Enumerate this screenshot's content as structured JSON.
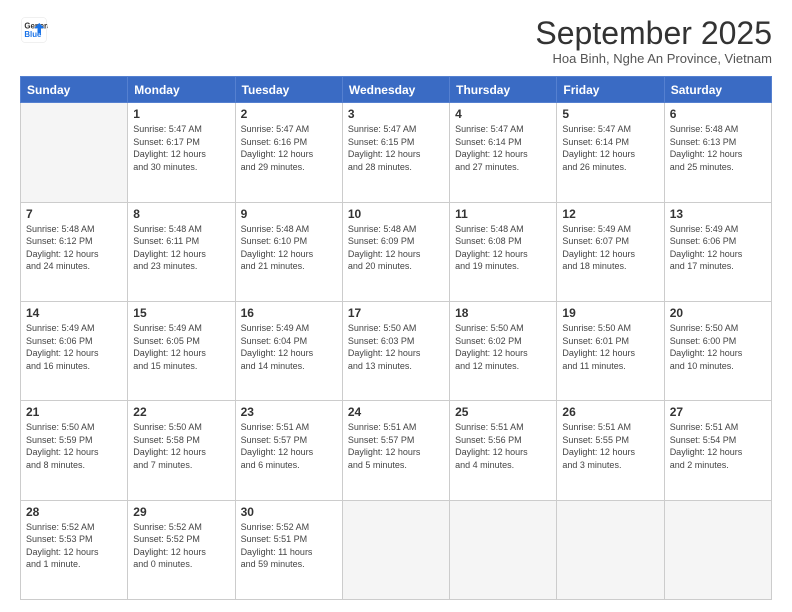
{
  "logo": {
    "line1": "General",
    "line2": "Blue"
  },
  "header": {
    "month": "September 2025",
    "location": "Hoa Binh, Nghe An Province, Vietnam"
  },
  "days": [
    "Sunday",
    "Monday",
    "Tuesday",
    "Wednesday",
    "Thursday",
    "Friday",
    "Saturday"
  ],
  "weeks": [
    [
      {
        "day": "",
        "info": ""
      },
      {
        "day": "1",
        "info": "Sunrise: 5:47 AM\nSunset: 6:17 PM\nDaylight: 12 hours\nand 30 minutes."
      },
      {
        "day": "2",
        "info": "Sunrise: 5:47 AM\nSunset: 6:16 PM\nDaylight: 12 hours\nand 29 minutes."
      },
      {
        "day": "3",
        "info": "Sunrise: 5:47 AM\nSunset: 6:15 PM\nDaylight: 12 hours\nand 28 minutes."
      },
      {
        "day": "4",
        "info": "Sunrise: 5:47 AM\nSunset: 6:14 PM\nDaylight: 12 hours\nand 27 minutes."
      },
      {
        "day": "5",
        "info": "Sunrise: 5:47 AM\nSunset: 6:14 PM\nDaylight: 12 hours\nand 26 minutes."
      },
      {
        "day": "6",
        "info": "Sunrise: 5:48 AM\nSunset: 6:13 PM\nDaylight: 12 hours\nand 25 minutes."
      }
    ],
    [
      {
        "day": "7",
        "info": "Sunrise: 5:48 AM\nSunset: 6:12 PM\nDaylight: 12 hours\nand 24 minutes."
      },
      {
        "day": "8",
        "info": "Sunrise: 5:48 AM\nSunset: 6:11 PM\nDaylight: 12 hours\nand 23 minutes."
      },
      {
        "day": "9",
        "info": "Sunrise: 5:48 AM\nSunset: 6:10 PM\nDaylight: 12 hours\nand 21 minutes."
      },
      {
        "day": "10",
        "info": "Sunrise: 5:48 AM\nSunset: 6:09 PM\nDaylight: 12 hours\nand 20 minutes."
      },
      {
        "day": "11",
        "info": "Sunrise: 5:48 AM\nSunset: 6:08 PM\nDaylight: 12 hours\nand 19 minutes."
      },
      {
        "day": "12",
        "info": "Sunrise: 5:49 AM\nSunset: 6:07 PM\nDaylight: 12 hours\nand 18 minutes."
      },
      {
        "day": "13",
        "info": "Sunrise: 5:49 AM\nSunset: 6:06 PM\nDaylight: 12 hours\nand 17 minutes."
      }
    ],
    [
      {
        "day": "14",
        "info": "Sunrise: 5:49 AM\nSunset: 6:06 PM\nDaylight: 12 hours\nand 16 minutes."
      },
      {
        "day": "15",
        "info": "Sunrise: 5:49 AM\nSunset: 6:05 PM\nDaylight: 12 hours\nand 15 minutes."
      },
      {
        "day": "16",
        "info": "Sunrise: 5:49 AM\nSunset: 6:04 PM\nDaylight: 12 hours\nand 14 minutes."
      },
      {
        "day": "17",
        "info": "Sunrise: 5:50 AM\nSunset: 6:03 PM\nDaylight: 12 hours\nand 13 minutes."
      },
      {
        "day": "18",
        "info": "Sunrise: 5:50 AM\nSunset: 6:02 PM\nDaylight: 12 hours\nand 12 minutes."
      },
      {
        "day": "19",
        "info": "Sunrise: 5:50 AM\nSunset: 6:01 PM\nDaylight: 12 hours\nand 11 minutes."
      },
      {
        "day": "20",
        "info": "Sunrise: 5:50 AM\nSunset: 6:00 PM\nDaylight: 12 hours\nand 10 minutes."
      }
    ],
    [
      {
        "day": "21",
        "info": "Sunrise: 5:50 AM\nSunset: 5:59 PM\nDaylight: 12 hours\nand 8 minutes."
      },
      {
        "day": "22",
        "info": "Sunrise: 5:50 AM\nSunset: 5:58 PM\nDaylight: 12 hours\nand 7 minutes."
      },
      {
        "day": "23",
        "info": "Sunrise: 5:51 AM\nSunset: 5:57 PM\nDaylight: 12 hours\nand 6 minutes."
      },
      {
        "day": "24",
        "info": "Sunrise: 5:51 AM\nSunset: 5:57 PM\nDaylight: 12 hours\nand 5 minutes."
      },
      {
        "day": "25",
        "info": "Sunrise: 5:51 AM\nSunset: 5:56 PM\nDaylight: 12 hours\nand 4 minutes."
      },
      {
        "day": "26",
        "info": "Sunrise: 5:51 AM\nSunset: 5:55 PM\nDaylight: 12 hours\nand 3 minutes."
      },
      {
        "day": "27",
        "info": "Sunrise: 5:51 AM\nSunset: 5:54 PM\nDaylight: 12 hours\nand 2 minutes."
      }
    ],
    [
      {
        "day": "28",
        "info": "Sunrise: 5:52 AM\nSunset: 5:53 PM\nDaylight: 12 hours\nand 1 minute."
      },
      {
        "day": "29",
        "info": "Sunrise: 5:52 AM\nSunset: 5:52 PM\nDaylight: 12 hours\nand 0 minutes."
      },
      {
        "day": "30",
        "info": "Sunrise: 5:52 AM\nSunset: 5:51 PM\nDaylight: 11 hours\nand 59 minutes."
      },
      {
        "day": "",
        "info": ""
      },
      {
        "day": "",
        "info": ""
      },
      {
        "day": "",
        "info": ""
      },
      {
        "day": "",
        "info": ""
      }
    ]
  ]
}
